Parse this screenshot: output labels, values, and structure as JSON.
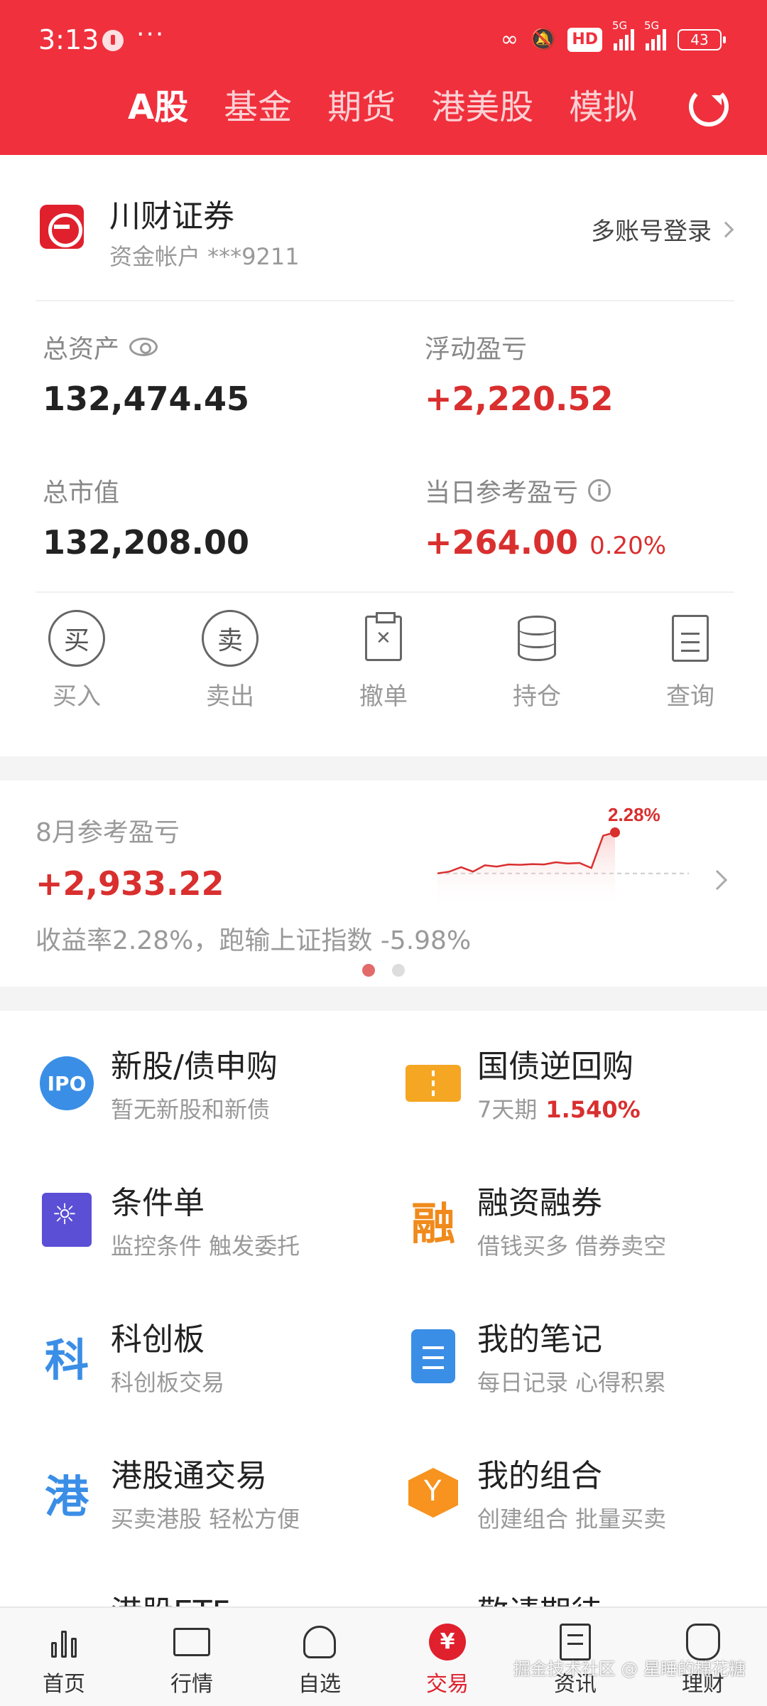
{
  "status_bar": {
    "time": "3:13",
    "dots": "···",
    "hd": "HD",
    "net1": "5G",
    "net2": "5G",
    "battery": "43"
  },
  "tabs": [
    "A股",
    "基金",
    "期货",
    "港美股",
    "模拟"
  ],
  "account": {
    "broker": "川财证券",
    "account_label": "资金帐户 ***9211",
    "multi_login": "多账号登录"
  },
  "metrics": {
    "total_assets_label": "总资产",
    "total_assets": "132,474.45",
    "floating_pl_label": "浮动盈亏",
    "floating_pl": "+2,220.52",
    "market_value_label": "总市值",
    "market_value": "132,208.00",
    "daily_pl_label": "当日参考盈亏",
    "daily_pl": "+264.00",
    "daily_pl_pct": "0.20%"
  },
  "actions": [
    "买入",
    "卖出",
    "撤单",
    "持仓",
    "查询"
  ],
  "action_glyphs": {
    "buy": "买",
    "sell": "卖"
  },
  "monthly": {
    "label": "8月参考盈亏",
    "value": "+2,933.22",
    "desc": "收益率2.28%，跑输上证指数 -5.98%",
    "spark_label": "2.28%"
  },
  "chart_data": {
    "type": "area",
    "values": [
      0.0,
      0.1,
      0.35,
      0.1,
      0.45,
      0.38,
      0.5,
      0.48,
      0.52,
      0.5,
      0.62,
      0.55,
      0.58,
      0.3,
      2.1,
      2.28
    ],
    "baseline": 0,
    "annotation": "2.28%"
  },
  "features": [
    {
      "title": "新股/债申购",
      "sub": "暂无新股和新债",
      "icon": "ipo-icon",
      "icon_text": "IPO"
    },
    {
      "title": "国债逆回购",
      "sub": "7天期",
      "sub_value": "1.540%",
      "icon": "ticket-icon"
    },
    {
      "title": "条件单",
      "sub": "监控条件 触发委托",
      "icon": "condition-icon"
    },
    {
      "title": "融资融券",
      "sub": "借钱买多 借券卖空",
      "icon": "margin-icon",
      "icon_text": "融"
    },
    {
      "title": "科创板",
      "sub": "科创板交易",
      "icon": "star-board-icon",
      "icon_text": "科"
    },
    {
      "title": "我的笔记",
      "sub": "每日记录 心得积累",
      "icon": "note-icon"
    },
    {
      "title": "港股通交易",
      "sub": "买卖港股 轻松方便",
      "icon": "hk-connect-icon",
      "icon_text": "港"
    },
    {
      "title": "我的组合",
      "sub": "创建组合 批量买卖",
      "icon": "portfolio-icon"
    }
  ],
  "partial_rows": [
    "港股ETF",
    "敬请期待"
  ],
  "bottom_nav": [
    "首页",
    "行情",
    "自选",
    "交易",
    "资讯",
    "理财"
  ],
  "watermark": "掘金技术社区 @ 星睡的棉花糖",
  "colors": {
    "brand_red": "#f0303d",
    "gain_red": "#d92f2f",
    "ipo_blue": "#3a8ee6",
    "orange": "#f5a623",
    "purple": "#5b4fd6"
  }
}
